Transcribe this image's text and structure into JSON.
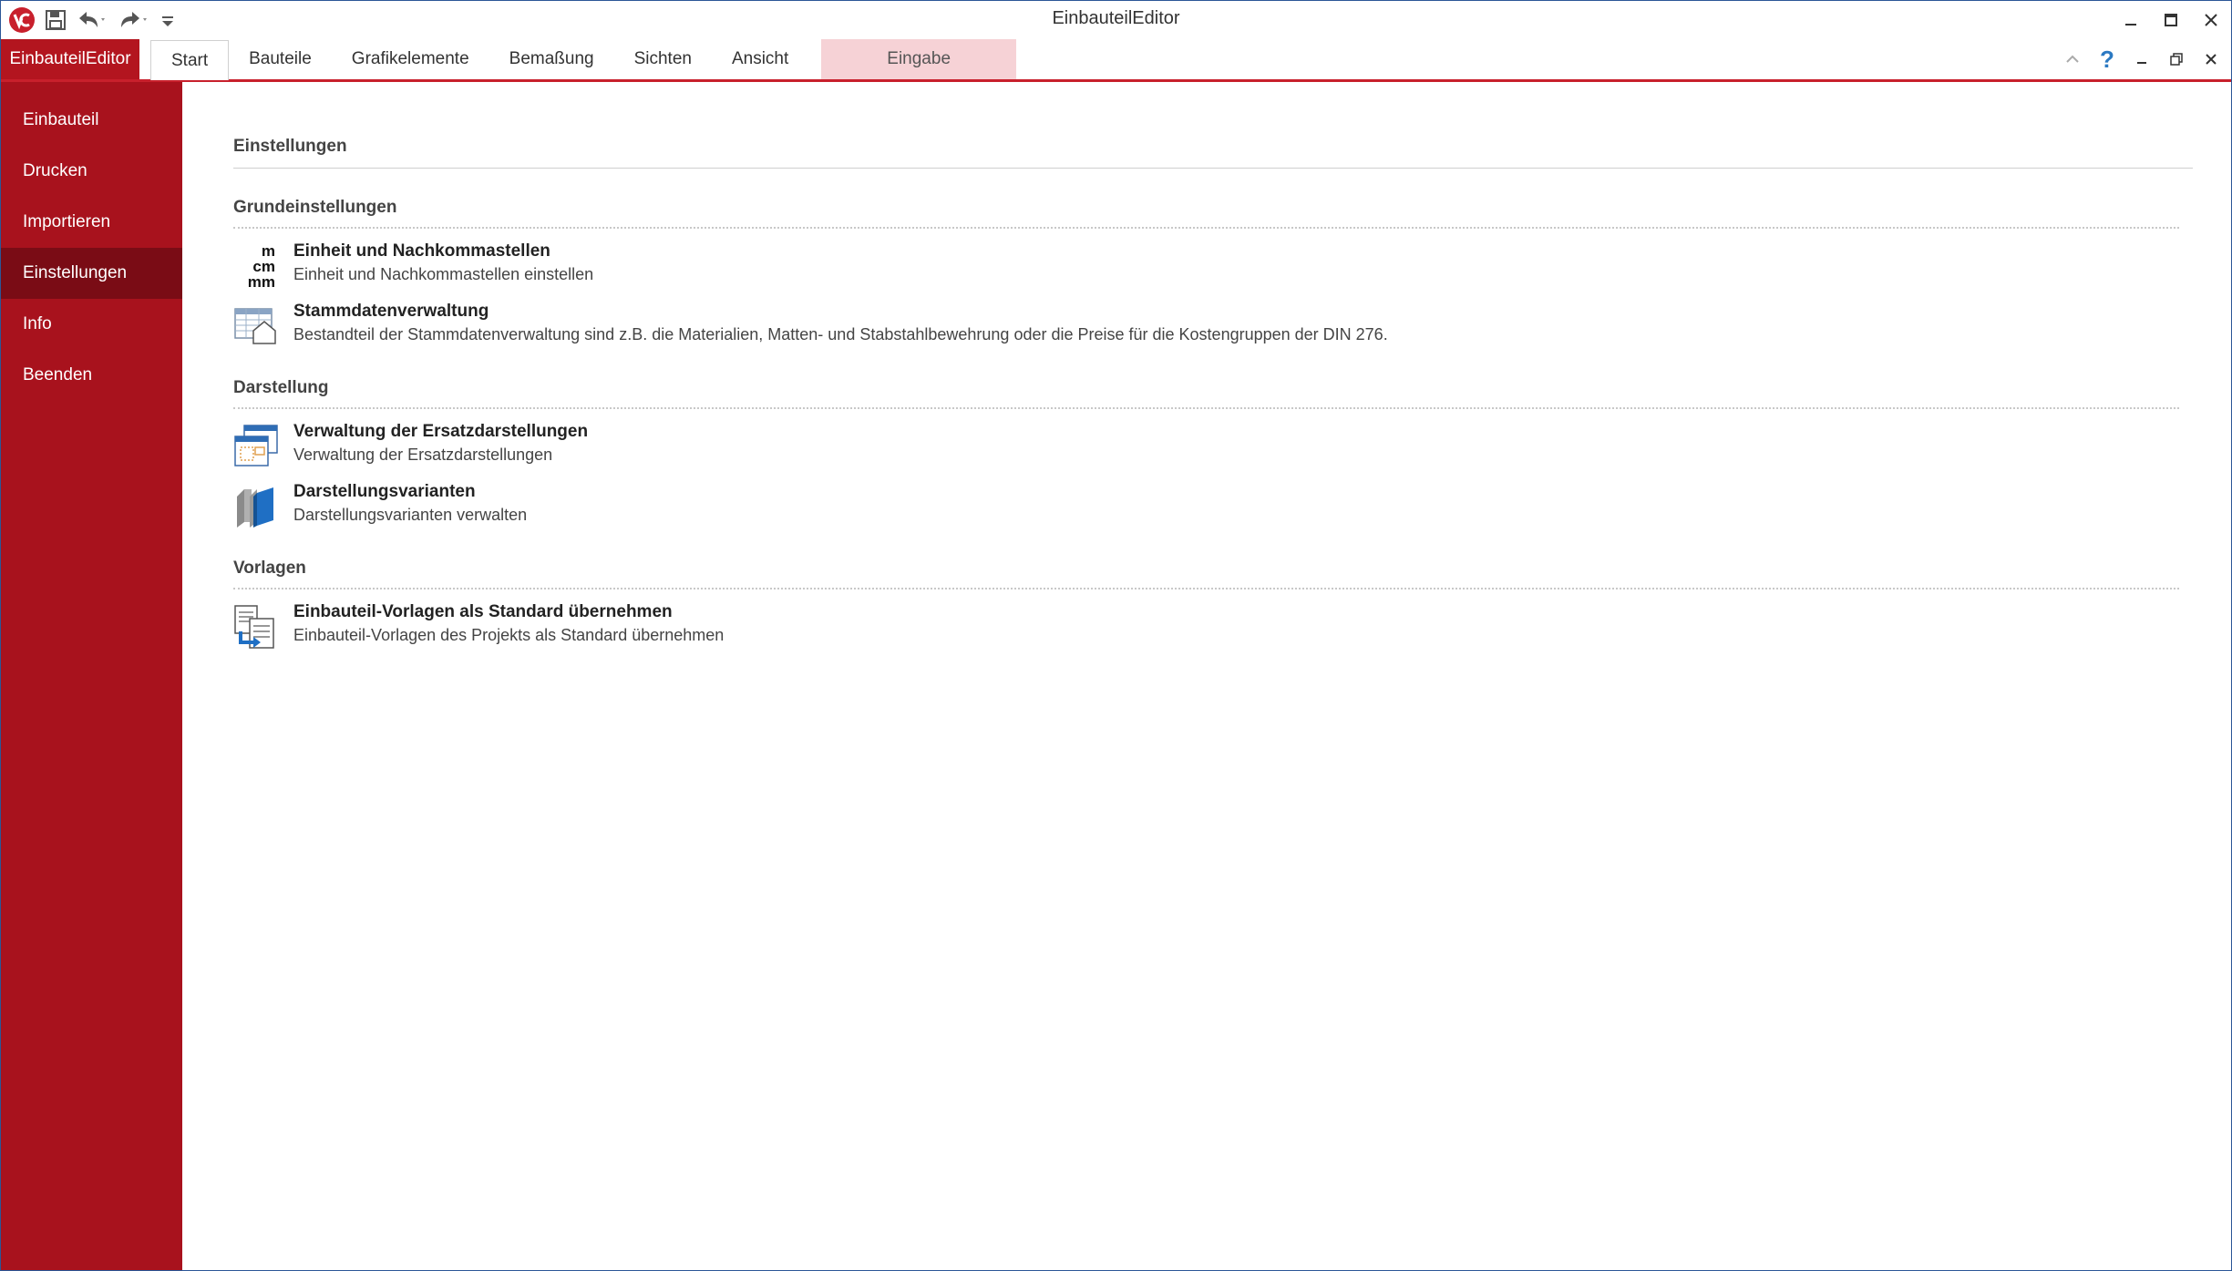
{
  "window": {
    "title": "EinbauteilEditor"
  },
  "qat": {
    "icons": [
      "app-logo-icon",
      "save-icon",
      "undo-icon",
      "redo-icon",
      "customize-icon"
    ]
  },
  "ribbon": {
    "file_tab": "EinbauteilEditor",
    "tabs": [
      "Start",
      "Bauteile",
      "Grafikelemente",
      "Bemaßung",
      "Sichten",
      "Ansicht"
    ],
    "context_tab": "Eingabe",
    "help_symbol": "?"
  },
  "sidebar": {
    "items": [
      {
        "label": "Einbauteil"
      },
      {
        "label": "Drucken"
      },
      {
        "label": "Importieren"
      },
      {
        "label": "Einstellungen",
        "active": true
      },
      {
        "label": "Info"
      },
      {
        "label": "Beenden"
      }
    ]
  },
  "main": {
    "title": "Einstellungen",
    "groups": [
      {
        "title": "Grundeinstellungen",
        "entries": [
          {
            "icon": "units-icon",
            "icon_text": [
              "m",
              "cm",
              "mm"
            ],
            "title": "Einheit und Nachkommastellen",
            "desc": "Einheit und Nachkommastellen einstellen"
          },
          {
            "icon": "master-data-icon",
            "title": "Stammdatenverwaltung",
            "desc": "Bestandteil der Stammdatenverwaltung sind z.B. die Materialien, Matten- und Stabstahlbewehrung oder die Preise für die Kostengruppen der DIN 276."
          }
        ]
      },
      {
        "title": "Darstellung",
        "entries": [
          {
            "icon": "substitute-display-icon",
            "title": "Verwaltung der Ersatzdarstellungen",
            "desc": "Verwaltung der Ersatzdarstellungen"
          },
          {
            "icon": "display-variants-icon",
            "title": "Darstellungsvarianten",
            "desc": "Darstellungsvarianten verwalten"
          }
        ]
      },
      {
        "title": "Vorlagen",
        "entries": [
          {
            "icon": "templates-icon",
            "title": "Einbauteil-Vorlagen als Standard übernehmen",
            "desc": "Einbauteil-Vorlagen des Projekts als Standard übernehmen"
          }
        ]
      }
    ]
  },
  "colors": {
    "accent": "#c8202c",
    "sidebar": "#a8121d",
    "sidebar_active": "#7a0c15",
    "context_tab": "#f6d2d6"
  }
}
